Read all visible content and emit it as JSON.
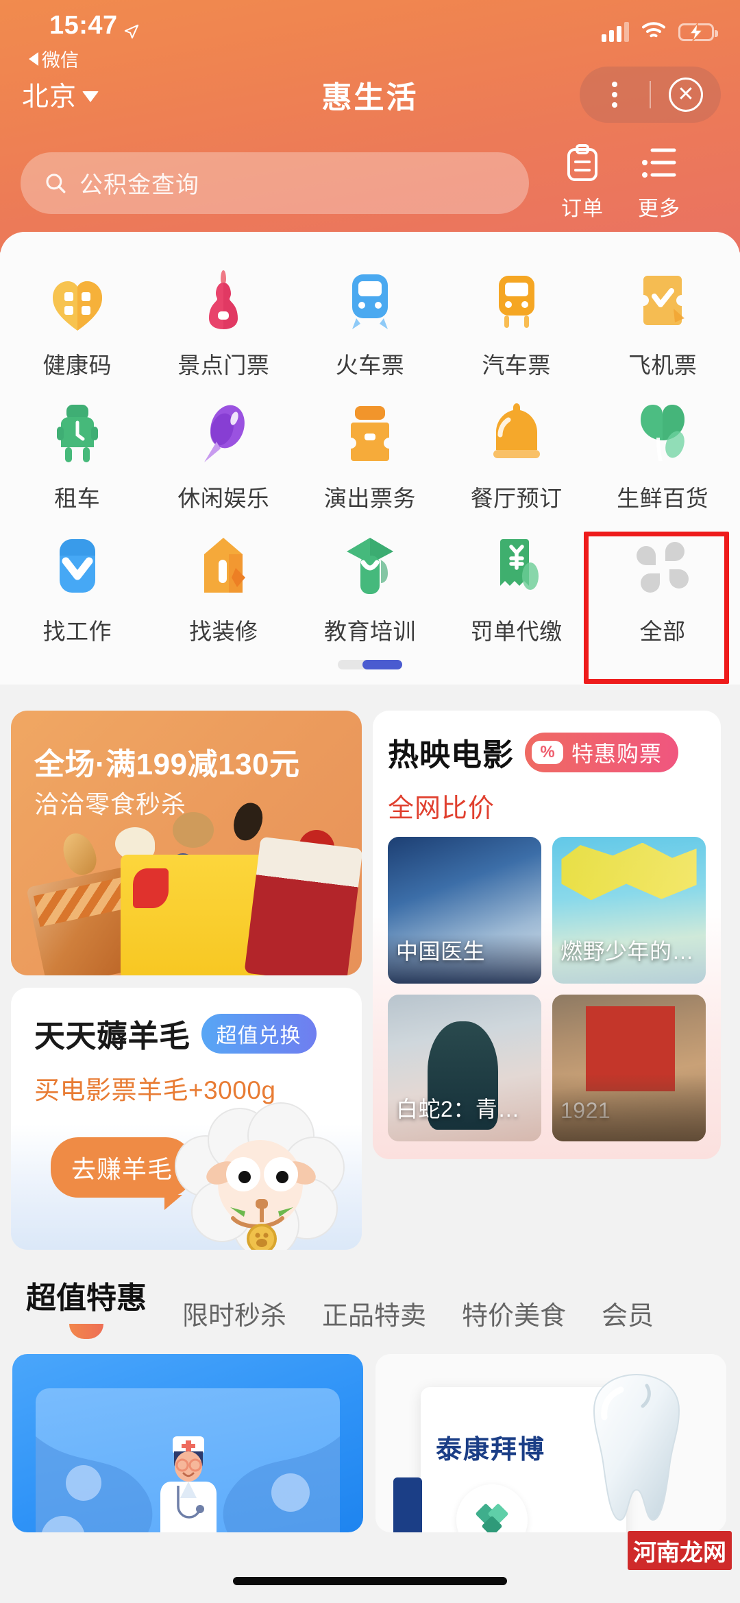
{
  "status_bar": {
    "time": "15:47",
    "location_icon": "location-arrow-icon",
    "back_label": "微信",
    "signal_icon": "signal-bars-icon",
    "wifi_icon": "wifi-icon",
    "battery_icon": "battery-charging-icon"
  },
  "nav": {
    "city": "北京",
    "title": "惠生活",
    "menu_icon": "more-dots-icon",
    "close_icon": "close-circle-icon"
  },
  "search": {
    "placeholder": "公积金查询",
    "icon": "search-icon"
  },
  "header_actions": [
    {
      "label": "订单",
      "icon": "clipboard-icon"
    },
    {
      "label": "更多",
      "icon": "list-menu-icon"
    }
  ],
  "grid": {
    "items": [
      {
        "label": "健康码",
        "icon": "health-code-icon",
        "color": "#f5b93f"
      },
      {
        "label": "景点门票",
        "icon": "attraction-ticket-icon",
        "color": "#e8436b"
      },
      {
        "label": "火车票",
        "icon": "train-ticket-icon",
        "color": "#4aa9f0"
      },
      {
        "label": "汽车票",
        "icon": "bus-ticket-icon",
        "color": "#f5a623"
      },
      {
        "label": "飞机票",
        "icon": "flight-ticket-icon",
        "color": "#f5bc52"
      },
      {
        "label": "租车",
        "icon": "car-rental-icon",
        "color": "#46b97a"
      },
      {
        "label": "休闲娱乐",
        "icon": "entertainment-icon",
        "color": "#9a52e0"
      },
      {
        "label": "演出票务",
        "icon": "show-ticket-icon",
        "color": "#f6ab3a"
      },
      {
        "label": "餐厅预订",
        "icon": "restaurant-icon",
        "color": "#f5a82b"
      },
      {
        "label": "生鲜百货",
        "icon": "grocery-icon",
        "color": "#4cbd82"
      },
      {
        "label": "找工作",
        "icon": "job-search-icon",
        "color": "#46a8f5"
      },
      {
        "label": "找装修",
        "icon": "home-decor-icon",
        "color": "#f5a93a"
      },
      {
        "label": "教育培训",
        "icon": "education-icon",
        "color": "#45b97c"
      },
      {
        "label": "罚单代缴",
        "icon": "fine-payment-icon",
        "color": "#3faf6e"
      },
      {
        "label": "全部",
        "icon": "all-clover-icon",
        "color": "#cccccc"
      }
    ],
    "page_indicator": {
      "pages": 2,
      "current": 2
    }
  },
  "highlight": {
    "target": "全部"
  },
  "promo_card": {
    "title": "全场·满199减130元",
    "subtitle": "洽洽零食秒杀",
    "image": "nuts-snack-bags-image"
  },
  "sheep_card": {
    "title": "天天薅羊毛",
    "badge": "超值兑换",
    "subtitle": "买电影票羊毛+3000g",
    "bubble": "去赚羊毛",
    "image": "cartoon-sheep-image"
  },
  "movies_card": {
    "title": "热映电影",
    "badge_icon": "percent-icon",
    "badge": "特惠购票",
    "subtitle": "全网比价",
    "posters": [
      {
        "caption": "中国医生",
        "art": "chinese-doctors-poster"
      },
      {
        "caption": "燃野少年的…",
        "art": "upcoming-summer-poster"
      },
      {
        "caption": "白蛇2：青…",
        "art": "white-snake-2-poster"
      },
      {
        "caption": "1921",
        "art": "1921-poster"
      }
    ]
  },
  "tabs": [
    {
      "label": "超值特惠",
      "active": true
    },
    {
      "label": "限时秒杀",
      "active": false
    },
    {
      "label": "正品特卖",
      "active": false
    },
    {
      "label": "特价美食",
      "active": false
    },
    {
      "label": "会员",
      "active": false
    }
  ],
  "bottom_cards": [
    {
      "art": "doctor-illustration",
      "brand": ""
    },
    {
      "art": "tooth-illustration",
      "brand": "泰康拜博"
    }
  ],
  "watermark": {
    "text": "河南龙网"
  },
  "colors": {
    "header_start": "#f18b4e",
    "header_end": "#ea7262",
    "accent_orange": "#ee6f55",
    "highlight_red": "#ee1b1b",
    "page_blue": "#4a5bd0",
    "sale_red": "#e0402f"
  }
}
